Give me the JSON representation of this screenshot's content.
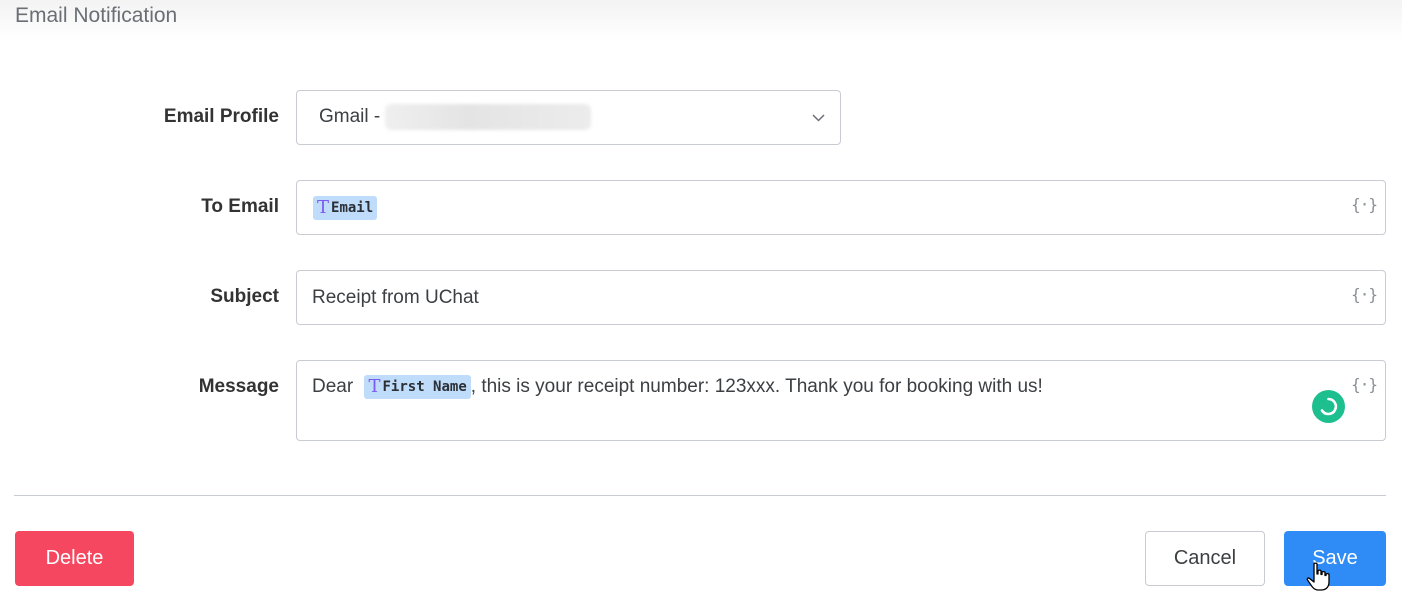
{
  "header": {
    "title": "Email Notification"
  },
  "form": {
    "email_profile": {
      "label": "Email Profile",
      "value": "Gmail -"
    },
    "to_email": {
      "label": "To Email",
      "tag_label": "Email",
      "var_icon": "{·}"
    },
    "subject": {
      "label": "Subject",
      "value": "Receipt from UChat",
      "var_icon": "{·}"
    },
    "message": {
      "label": "Message",
      "prefix": "Dear",
      "tag_label": "First Name",
      "suffix": ", this is your receipt number: 123xxx. Thank you for booking with us!",
      "var_icon": "{·}"
    }
  },
  "actions": {
    "delete_label": "Delete",
    "cancel_label": "Cancel",
    "save_label": "Save"
  },
  "icons": {
    "dropdown": "chevron-down-icon",
    "variable": "braces-icon",
    "tag_type": "text-type-icon",
    "loader": "spinner-icon",
    "cursor": "hand-pointer-icon"
  },
  "colors": {
    "delete": "#f5475f",
    "save": "#2f8cf6",
    "tag_bg": "#bfdcfb",
    "tag_icon": "#7c5cf0",
    "spinner": "#1dbf8e"
  }
}
